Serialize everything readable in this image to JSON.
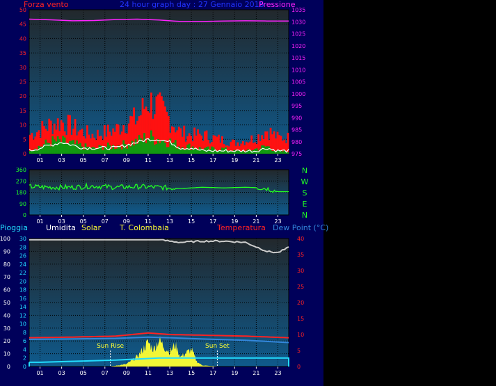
{
  "header": {
    "wind_label": "Forza vento",
    "title": "24 hour graph day : 27 Gennaio 2016",
    "pressure_label": "Pressione"
  },
  "direction_labels": [
    "N",
    "W",
    "S",
    "E",
    "N"
  ],
  "lower_header": {
    "rain_label": "Pioggia",
    "humidity_label": "Umidita",
    "solar_label": "Solar",
    "station_label": "T. Colombaia",
    "temperature_label": "Temperatura",
    "dewpoint_label": "Dew Point (°C)"
  },
  "sun": {
    "rise_label": "Sun Rise",
    "set_label": "Sun Set",
    "rise_hour": 7.5,
    "set_hour": 17.4
  },
  "colors": {
    "background": "#00005a",
    "plot_bg_top": "#22282c",
    "plot_bg_bottom": "#0f5a8c",
    "wind_axis": "#ff2222",
    "pressure": "#ff22ff",
    "title": "#2233ff",
    "direction": "#22ff22",
    "rain": "#22ddff",
    "humidity": "#cccccc",
    "solar": "#ffff33",
    "temperature": "#ff2222",
    "dewpoint": "#3388dd",
    "grid": "#000000"
  },
  "chart_data": [
    {
      "type": "bar",
      "name": "wind",
      "title": "24 hour graph day : 27 Gennaio 2016",
      "ylabel": "Forza vento",
      "y2label": "Pressione",
      "x_ticks": [
        "01",
        "03",
        "05",
        "07",
        "09",
        "11",
        "13",
        "15",
        "17",
        "19",
        "21",
        "23"
      ],
      "ylim": [
        0,
        50
      ],
      "yticks": [
        0,
        5,
        10,
        15,
        20,
        25,
        30,
        35,
        40,
        45,
        50
      ],
      "y2lim": [
        975,
        1035
      ],
      "y2ticks": [
        975,
        980,
        985,
        990,
        995,
        1000,
        1005,
        1010,
        1015,
        1020,
        1025,
        1030,
        1035
      ],
      "gust_hours": [
        0,
        1,
        2,
        3,
        4,
        5,
        6,
        7,
        8,
        9,
        10,
        11,
        12,
        13,
        14,
        15,
        16,
        17,
        18,
        19,
        20,
        21,
        22,
        23
      ],
      "gust": [
        7,
        9,
        11,
        12,
        10,
        8,
        7,
        8,
        9,
        12,
        13,
        20,
        17,
        13,
        8,
        7,
        7,
        6,
        5,
        4,
        5,
        6,
        9,
        6
      ],
      "speed": [
        2,
        3,
        5,
        5,
        4,
        3,
        2,
        3,
        3,
        4,
        5,
        7,
        6,
        5,
        3,
        3,
        2,
        2,
        2,
        1,
        1,
        2,
        3,
        1
      ],
      "average": [
        1,
        2,
        3,
        4,
        3,
        2,
        2,
        2,
        2,
        3,
        4,
        5,
        5,
        4,
        2,
        2,
        1,
        1,
        1,
        1,
        1,
        1,
        2,
        1
      ],
      "pressure_hours": [
        0,
        2,
        4,
        6,
        8,
        10,
        12,
        14,
        16,
        18,
        20,
        22,
        24
      ],
      "pressure": [
        1031.1,
        1030.8,
        1030.4,
        1030.5,
        1030.9,
        1031.1,
        1030.7,
        1030.1,
        1030.1,
        1030.3,
        1030.4,
        1030.3,
        1030.3
      ]
    },
    {
      "type": "line",
      "name": "wind-direction",
      "x_ticks": [
        "01",
        "03",
        "05",
        "07",
        "09",
        "11",
        "13",
        "15",
        "17",
        "19",
        "21",
        "23"
      ],
      "ylim": [
        0,
        360
      ],
      "yticks": [
        0,
        90,
        180,
        270,
        360
      ],
      "hours": [
        0,
        2,
        4,
        6,
        8,
        10,
        12,
        14,
        16,
        18,
        20,
        21.5,
        22,
        23,
        24
      ],
      "direction": [
        225,
        220,
        220,
        230,
        220,
        225,
        220,
        210,
        220,
        215,
        220,
        215,
        210,
        185,
        185
      ]
    },
    {
      "type": "line",
      "name": "rain-humidity-solar-temperature",
      "x_ticks": [
        "01",
        "03",
        "05",
        "07",
        "09",
        "11",
        "13",
        "15",
        "17",
        "19",
        "21",
        "23"
      ],
      "ylim": [
        0,
        100
      ],
      "yticks": [
        0,
        10,
        20,
        30,
        40,
        50,
        60,
        70,
        80,
        90,
        100
      ],
      "rain_ticks": [
        0,
        2,
        4,
        6,
        8,
        10,
        12,
        14,
        16,
        18,
        20,
        22,
        24,
        26,
        28,
        30
      ],
      "temp_ylim": [
        0,
        40
      ],
      "temp_ticks": [
        0,
        5,
        10,
        15,
        20,
        25,
        30,
        35,
        40
      ],
      "humidity_hours": [
        0,
        12,
        14,
        16,
        18,
        20,
        22,
        23,
        24
      ],
      "humidity": [
        99,
        99,
        97,
        98,
        98,
        97,
        90,
        89,
        93
      ],
      "temperature_hours": [
        0,
        4,
        8,
        11,
        13,
        16,
        20,
        24
      ],
      "temperature": [
        9.0,
        9.2,
        9.5,
        10.5,
        10.0,
        9.8,
        9.5,
        9.0
      ],
      "dewpoint_hours": [
        0,
        4,
        8,
        11,
        13,
        16,
        20,
        24
      ],
      "dewpoint": [
        8.5,
        8.6,
        8.8,
        9.2,
        9.0,
        8.6,
        8.2,
        7.5
      ],
      "solar_hours": [
        7.5,
        9,
        10,
        11,
        11.5,
        12,
        12.5,
        13,
        13.5,
        14,
        15,
        15.5,
        16,
        17.4
      ],
      "solar": [
        0,
        2,
        8,
        20,
        14,
        22,
        16,
        12,
        18,
        8,
        14,
        4,
        1,
        0
      ],
      "rain_hours": [
        0,
        0.6,
        1,
        8,
        12,
        24
      ],
      "rain": [
        1,
        1,
        1,
        1.5,
        2,
        2
      ]
    }
  ]
}
